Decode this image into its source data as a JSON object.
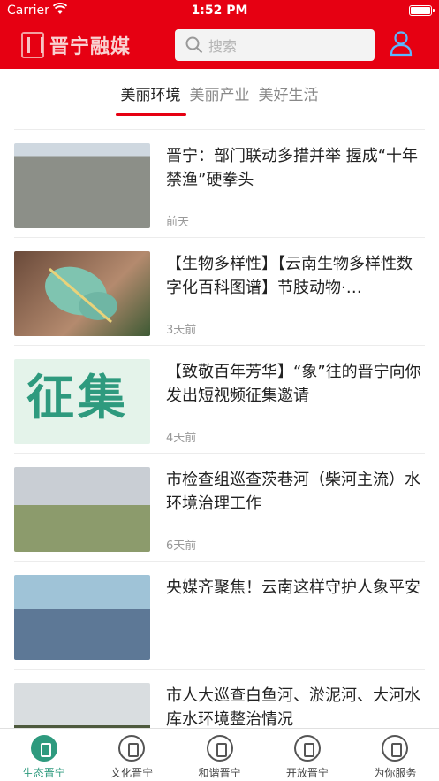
{
  "status_bar": {
    "carrier": "Carrier",
    "time": "1:52 PM"
  },
  "header": {
    "logo_text": "晋宁融媒",
    "search_placeholder": "搜索",
    "colors": {
      "brand_red": "#e60012",
      "accent_green": "#2e9a7e"
    }
  },
  "tabs": [
    {
      "label": "美丽环境",
      "active": true
    },
    {
      "label": "美丽产业",
      "active": false
    },
    {
      "label": "美好生活",
      "active": false
    }
  ],
  "news": [
    {
      "title": "晋宁：部门联动多措并举  握成“十年禁渔”硬拳头",
      "time": "前天"
    },
    {
      "title": "【生物多样性】【云南生物多样性数字化百科图谱】节肢动物·…",
      "time": "3天前"
    },
    {
      "title": "【致敬百年芳华】“象”往的晋宁向你发出短视频征集邀请",
      "time": "4天前",
      "thumb_text": "征集"
    },
    {
      "title": "市检查组巡查茨巷河（柴河主流）水环境治理工作",
      "time": "6天前"
    },
    {
      "title": "央媒齐聚焦！云南这样守护人象平安",
      "time": ""
    },
    {
      "title": "市人大巡查白鱼河、淤泥河、大河水库水环境整治情况",
      "time": ""
    }
  ],
  "tabbar": [
    {
      "label": "生态晋宁",
      "icon": "ecology-icon",
      "active": true
    },
    {
      "label": "文化晋宁",
      "icon": "culture-icon",
      "active": false
    },
    {
      "label": "和谐晋宁",
      "icon": "harmony-icon",
      "active": false
    },
    {
      "label": "开放晋宁",
      "icon": "open-icon",
      "active": false
    },
    {
      "label": "为你服务",
      "icon": "service-icon",
      "active": false
    }
  ]
}
